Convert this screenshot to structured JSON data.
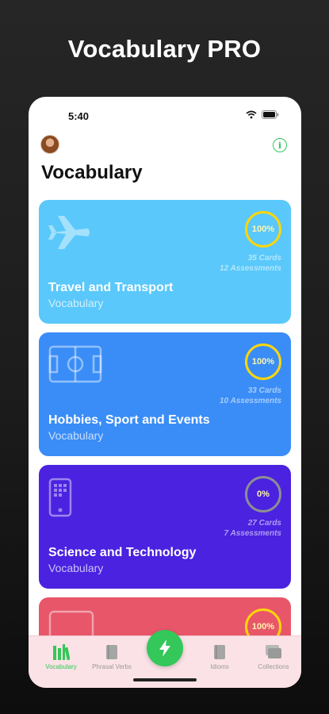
{
  "promo": {
    "title": "Vocabulary PRO"
  },
  "status_bar": {
    "time": "5:40"
  },
  "header": {
    "title": "Vocabulary",
    "info_icon": "info-icon"
  },
  "cards": [
    {
      "title": "Travel and Transport",
      "subtitle": "Vocabulary",
      "progress": "100%",
      "cards": "35 Cards",
      "assessments": "12 Assessments",
      "color": "#5ac8fa",
      "ring_color": "#ffd60a",
      "icon": "airplane-icon"
    },
    {
      "title": "Hobbies, Sport and Events",
      "subtitle": "Vocabulary",
      "progress": "100%",
      "cards": "33 Cards",
      "assessments": "10 Assessments",
      "color": "#3a8df7",
      "ring_color": "#ffd60a",
      "icon": "football-field-icon"
    },
    {
      "title": "Science and Technology",
      "subtitle": "Vocabulary",
      "progress": "0%",
      "cards": "27 Cards",
      "assessments": "7 Assessments",
      "color": "#4a22e0",
      "ring_color": "#8e8e93",
      "icon": "phone-device-icon"
    },
    {
      "progress": "100%",
      "color": "#e8566a",
      "ring_color": "#ffd60a",
      "icon": "card-icon"
    }
  ],
  "tabs": [
    {
      "label": "Vocabulary",
      "icon": "books-icon",
      "active": true
    },
    {
      "label": "Phrasal Verbs",
      "icon": "book-icon",
      "active": false
    },
    {
      "label": "Idioms",
      "icon": "book-icon",
      "active": false
    },
    {
      "label": "Collections",
      "icon": "stack-icon",
      "active": false
    }
  ],
  "center_action": {
    "icon": "lightning-icon",
    "color": "#34c759"
  }
}
